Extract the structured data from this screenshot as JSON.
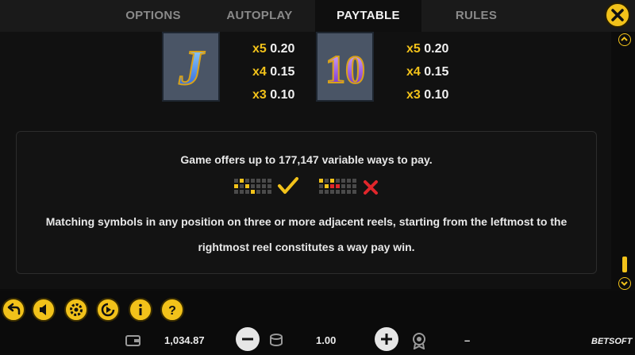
{
  "tabs": [
    {
      "label": "OPTIONS"
    },
    {
      "label": "AUTOPLAY"
    },
    {
      "label": "PAYTABLE"
    },
    {
      "label": "RULES"
    }
  ],
  "active_tab": "PAYTABLE",
  "symbols": [
    {
      "glyph": "J",
      "pays": [
        {
          "mult": "x5",
          "value": "0.20"
        },
        {
          "mult": "x4",
          "value": "0.15"
        },
        {
          "mult": "x3",
          "value": "0.10"
        }
      ]
    },
    {
      "glyph": "10",
      "pays": [
        {
          "mult": "x5",
          "value": "0.20"
        },
        {
          "mult": "x4",
          "value": "0.15"
        },
        {
          "mult": "x3",
          "value": "0.10"
        }
      ]
    }
  ],
  "info": {
    "ways_text": "Game offers up to 177,147 variable ways to pay.",
    "line1": "Matching symbols in any position on three or more adjacent reels, starting from the leftmost to the",
    "line2": "rightmost reel constitutes a way pay win."
  },
  "status": {
    "balance": "1,034.87",
    "bet": "1.00",
    "win": "–"
  },
  "brand": "BETSOFT",
  "colors": {
    "accent": "#f2c21a",
    "valid": "#f2c21a",
    "invalid": "#e0262b"
  },
  "icons": [
    "close-icon",
    "back-icon",
    "sound-icon",
    "settings-icon",
    "autoplay-icon",
    "info-icon",
    "help-icon",
    "wallet-icon",
    "coins-icon",
    "minus-icon",
    "plus-icon",
    "win-badge-icon",
    "checkmark-icon",
    "cross-icon"
  ]
}
